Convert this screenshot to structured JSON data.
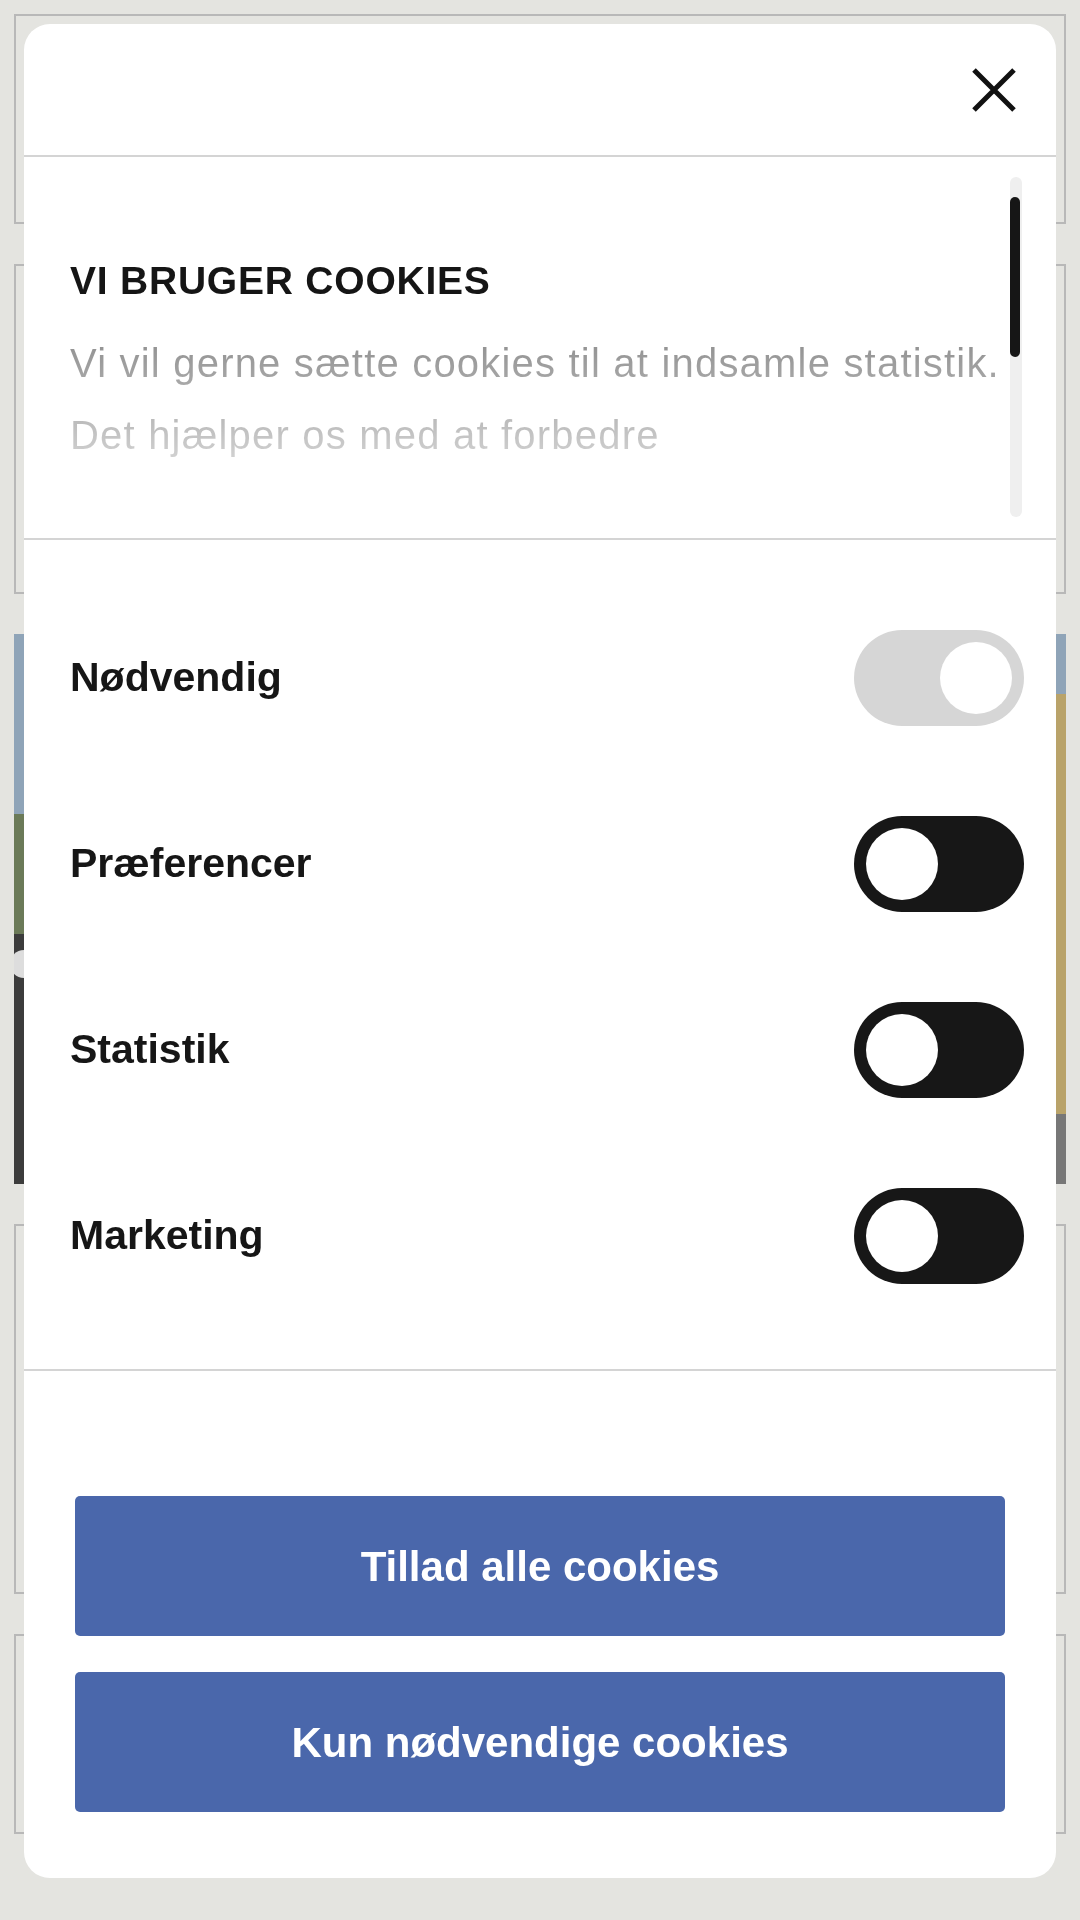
{
  "dialog": {
    "heading": "VI BRUGER COOKIES",
    "description": "Vi vil gerne sætte cookies til at indsamle statistik. Det hjælper os med at forbedre",
    "categories": [
      {
        "label": "Nødvendig",
        "on": true,
        "disabled": true
      },
      {
        "label": "Præferencer",
        "on": false,
        "disabled": false
      },
      {
        "label": "Statistik",
        "on": false,
        "disabled": false
      },
      {
        "label": "Marketing",
        "on": false,
        "disabled": false
      }
    ],
    "buttons": [
      "Tillad alle cookies",
      "Kun nødvendige cookies"
    ]
  }
}
